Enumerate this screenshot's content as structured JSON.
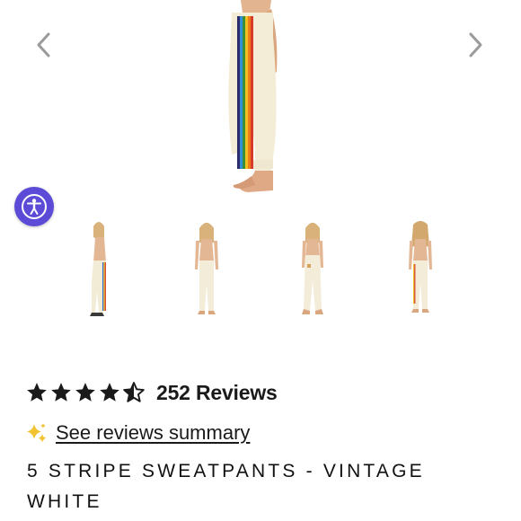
{
  "gallery": {
    "prev_icon": "chevron-left-icon",
    "next_icon": "chevron-right-icon",
    "thumbnail_count": 4
  },
  "accessibility": {
    "icon": "accessibility-icon",
    "color": "#5b4bd6"
  },
  "product": {
    "rating": 4.5,
    "stars_max": 5,
    "reviews_label": "252 Reviews",
    "summary_icon": "sparkles-icon",
    "summary_link": "See reviews summary",
    "title": "5 STRIPE SWEATPANTS - VINTAGE WHITE"
  },
  "colors": {
    "accent": "#5b4bd6",
    "sparkle": "#f2c230",
    "arrow": "#9a9a9a",
    "text": "#1a1a1a"
  }
}
